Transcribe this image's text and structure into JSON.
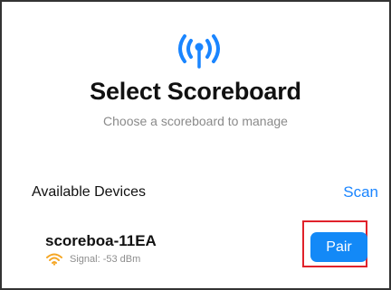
{
  "header": {
    "icon": "antenna-broadcast-icon",
    "title": "Select Scoreboard",
    "subtitle": "Choose a scoreboard to manage"
  },
  "devices_section": {
    "title": "Available Devices",
    "scan_label": "Scan"
  },
  "devices": [
    {
      "name": "scoreboa-11EA",
      "signal_icon": "wifi-signal-icon",
      "signal_text": "Signal: -53 dBm",
      "action_label": "Pair"
    }
  ],
  "colors": {
    "accent": "#1a85ff",
    "button": "#1389f7",
    "signal": "#f5a623",
    "highlight": "#e0222b"
  }
}
